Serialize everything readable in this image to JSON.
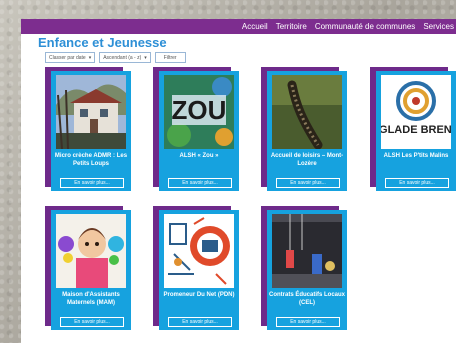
{
  "nav": [
    "Accueil",
    "Territoire",
    "Communauté de communes",
    "Services"
  ],
  "page_title": "Enfance et Jeunesse",
  "filters": {
    "sort_select": "Classer par date",
    "order_select": "Ascendant (a - z)",
    "filter_button": "Filtrer"
  },
  "cards": [
    {
      "title": "Micro crèche ADMR : Les Petits Loups",
      "more": "En savoir plus..."
    },
    {
      "title": "ALSH « Zou »",
      "more": "En savoir plus...",
      "image_text": "ZOU"
    },
    {
      "title": "Accueil de loisirs – Mont-Lozère",
      "more": "En savoir plus..."
    },
    {
      "title": "ALSH Les P'tits Malins",
      "more": "En savoir plus...",
      "image_text": "LANGLADE BRENOUX"
    },
    {
      "title": "Maison d'Assistants Maternels (MAM)",
      "more": "En savoir plus..."
    },
    {
      "title": "Promeneur Du Net (PDN)",
      "more": "En savoir plus..."
    },
    {
      "title": "Contrats Éducatifs Locaux (CEL)",
      "more": "En savoir plus..."
    }
  ],
  "colors": {
    "purple": "#7d2d8f",
    "blue": "#16a2df",
    "title_blue": "#2d8fd6"
  }
}
